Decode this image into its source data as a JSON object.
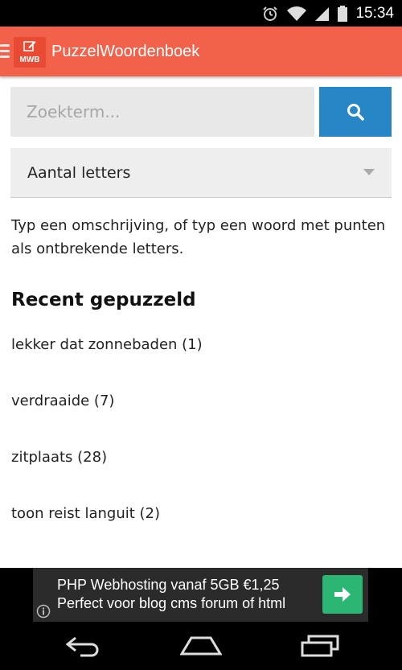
{
  "status_bar": {
    "time": "15:34",
    "icons": [
      "alarm-icon",
      "wifi-icon",
      "signal-icon",
      "battery-icon"
    ]
  },
  "app_bar": {
    "logo_text": "MWB",
    "title": "PuzzelWoordenboek"
  },
  "search": {
    "placeholder": "Zoekterm...",
    "value": "",
    "button_icon": "search-icon",
    "button_color": "#2686c6"
  },
  "letters_select": {
    "selected": "Aantal letters"
  },
  "instructions": "Typ een omschrijving, of typ een woord met punten als ontbrekende letters.",
  "recent": {
    "title": "Recent gepuzzeld",
    "items": [
      "lekker dat zonnebaden (1)",
      "verdraaide (7)",
      "zitplaats (28)",
      "toon reist languit (2)"
    ]
  },
  "ad": {
    "line1": "PHP Webhosting vanaf 5GB €1,25",
    "line2": "Perfect voor blog cms forum of html",
    "button_icon": "arrow-right-icon",
    "button_color": "#2bb673"
  },
  "nav_bar": {
    "icons": [
      "back-icon",
      "home-icon",
      "recent-apps-icon"
    ]
  },
  "colors": {
    "app_bar": "#f2624a",
    "search_button": "#2686c6",
    "ad_button": "#2bb673"
  }
}
